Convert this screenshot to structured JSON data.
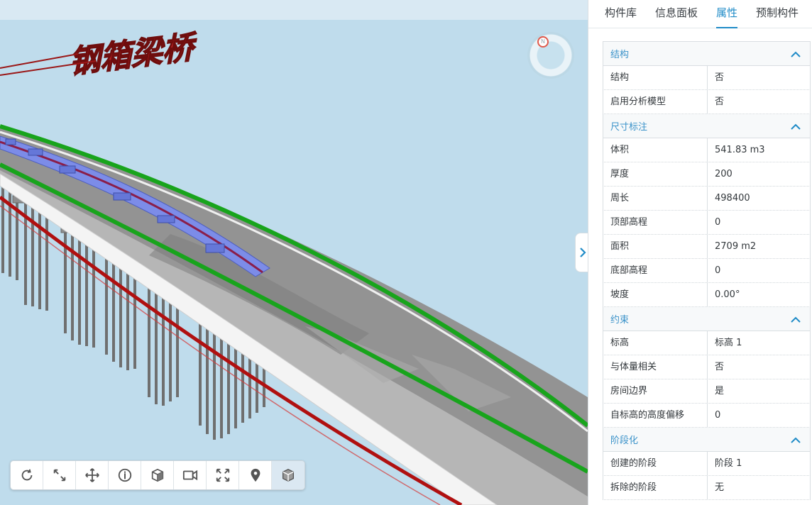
{
  "viewport": {
    "scene_text": "钢箱梁桥",
    "compass_label": "N"
  },
  "toolbar": {
    "tools": [
      {
        "icon": "rotate-icon"
      },
      {
        "icon": "zoom-region-icon"
      },
      {
        "icon": "pan-move-icon"
      },
      {
        "icon": "info-icon"
      },
      {
        "icon": "section-box-icon"
      },
      {
        "icon": "camera-icon"
      },
      {
        "icon": "fullscreen-icon"
      },
      {
        "icon": "location-pin-icon"
      },
      {
        "icon": "model-cube-icon",
        "active": true
      }
    ]
  },
  "panel": {
    "tabs": [
      {
        "label": "构件库",
        "active": false
      },
      {
        "label": "信息面板",
        "active": false
      },
      {
        "label": "属性",
        "active": true
      },
      {
        "label": "预制构件",
        "active": false
      }
    ],
    "sections": [
      {
        "title": "结构",
        "rows": [
          {
            "key": "结构",
            "value": "否"
          },
          {
            "key": "启用分析模型",
            "value": "否"
          }
        ]
      },
      {
        "title": "尺寸标注",
        "rows": [
          {
            "key": "体积",
            "value": "541.83 m3"
          },
          {
            "key": "厚度",
            "value": "200"
          },
          {
            "key": "周长",
            "value": "498400"
          },
          {
            "key": "顶部高程",
            "value": "0"
          },
          {
            "key": "面积",
            "value": "2709 m2"
          },
          {
            "key": "底部高程",
            "value": "0"
          },
          {
            "key": "坡度",
            "value": "0.00°"
          }
        ]
      },
      {
        "title": "约束",
        "rows": [
          {
            "key": "标高",
            "value": "标高 1"
          },
          {
            "key": "与体量相关",
            "value": "否"
          },
          {
            "key": "房间边界",
            "value": "是"
          },
          {
            "key": "自标高的高度偏移",
            "value": "0"
          }
        ]
      },
      {
        "title": "阶段化",
        "rows": [
          {
            "key": "创建的阶段",
            "value": "阶段 1"
          },
          {
            "key": "拆除的阶段",
            "value": "无"
          }
        ]
      }
    ]
  },
  "colors": {
    "accent": "#1f8bc7",
    "sky": "#bfdcec",
    "deck": "#8f8f8f",
    "rail_green": "#18a41c",
    "pipe_red": "#b01010",
    "box_blue": "#7c8ce8"
  }
}
